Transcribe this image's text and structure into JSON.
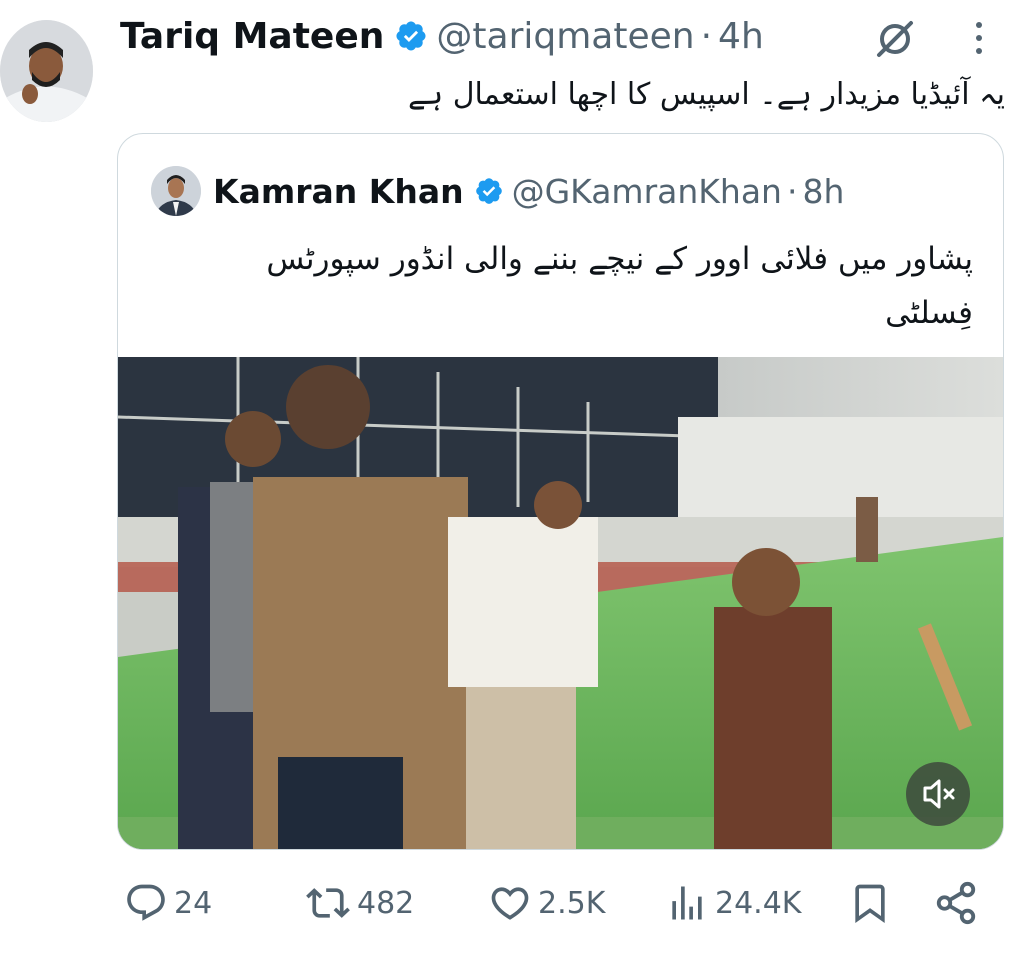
{
  "tweet": {
    "author_name": "Tariq Mateen",
    "handle": "@tariqmateen",
    "separator": "·",
    "time": "4h",
    "text": "یہ آئیڈیا مزیدار ہے۔ اسپیس کا اچھا استعمال ہے"
  },
  "quote": {
    "author_name": "Kamran Khan",
    "handle": "@GKamranKhan",
    "separator": "·",
    "time": "8h",
    "text": "پشاور میں فلائی اوور کے نیچے بننے والی انڈور سپورٹس فِسلٹی"
  },
  "actions": {
    "replies": "24",
    "reposts": "482",
    "likes": "2.5K",
    "views": "24.4K"
  },
  "icons": {
    "verified": "verified-badge-icon",
    "grok": "grok-icon",
    "more": "more-options-icon",
    "mute": "muted-speaker-icon",
    "reply": "reply-icon",
    "repost": "repost-icon",
    "like": "heart-icon",
    "views": "views-icon",
    "bookmark": "bookmark-icon",
    "share": "share-icon"
  },
  "colors": {
    "verified": "#1d9bf0",
    "text": "#0f1419",
    "secondary": "#536471",
    "border": "#cfd9de"
  }
}
